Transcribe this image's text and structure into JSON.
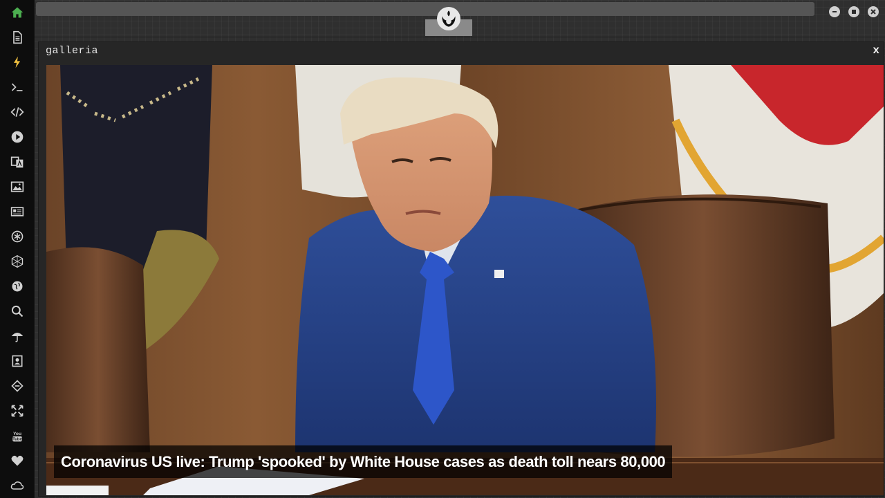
{
  "sidebar": {
    "items": [
      {
        "icon": "home-icon",
        "active": true
      },
      {
        "icon": "document-icon"
      },
      {
        "icon": "lightning-icon"
      },
      {
        "icon": "terminal-icon"
      },
      {
        "icon": "code-icon"
      },
      {
        "icon": "play-icon"
      },
      {
        "icon": "translate-icon"
      },
      {
        "icon": "image-icon"
      },
      {
        "icon": "newspaper-icon"
      },
      {
        "icon": "rebel-alliance-icon"
      },
      {
        "icon": "network-icon"
      },
      {
        "icon": "globe-icon"
      },
      {
        "icon": "search-icon"
      },
      {
        "icon": "umbrella-icon"
      },
      {
        "icon": "contact-card-icon"
      },
      {
        "icon": "diamond-arrows-icon"
      },
      {
        "icon": "expand-icon"
      },
      {
        "icon": "youtube-icon",
        "label": "You Tube"
      },
      {
        "icon": "heart-icon"
      },
      {
        "icon": "cloud-icon"
      }
    ],
    "accent_color": "#4caf50"
  },
  "window": {
    "controls": [
      "minimize-icon",
      "maximize-icon",
      "close-icon"
    ]
  },
  "panel": {
    "title": "galleria",
    "close_label": "x"
  },
  "gallery": {
    "caption": "Coronavirus US live: Trump 'spooked' by White House cases as death toll nears 80,000"
  }
}
